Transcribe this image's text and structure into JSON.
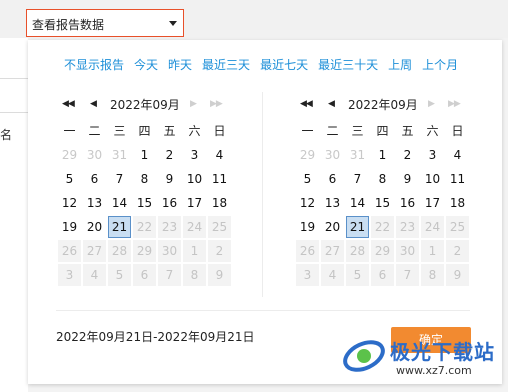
{
  "report_selector": {
    "value": "查看报告数据"
  },
  "table": {
    "column_label": "名"
  },
  "quick_ranges": [
    "不显示报告",
    "今天",
    "昨天",
    "最近三天",
    "最近七天",
    "最近三十天",
    "上周",
    "上个月"
  ],
  "weekdays": [
    "一",
    "二",
    "三",
    "四",
    "五",
    "六",
    "日"
  ],
  "calendars": [
    {
      "title": "2022年09月",
      "days": [
        {
          "d": "29",
          "s": "pre"
        },
        {
          "d": "30",
          "s": "pre"
        },
        {
          "d": "31",
          "s": "pre"
        },
        {
          "d": "1",
          "s": ""
        },
        {
          "d": "2",
          "s": ""
        },
        {
          "d": "3",
          "s": ""
        },
        {
          "d": "4",
          "s": ""
        },
        {
          "d": "5",
          "s": ""
        },
        {
          "d": "6",
          "s": ""
        },
        {
          "d": "7",
          "s": ""
        },
        {
          "d": "8",
          "s": ""
        },
        {
          "d": "9",
          "s": ""
        },
        {
          "d": "10",
          "s": ""
        },
        {
          "d": "11",
          "s": ""
        },
        {
          "d": "12",
          "s": ""
        },
        {
          "d": "13",
          "s": ""
        },
        {
          "d": "14",
          "s": ""
        },
        {
          "d": "15",
          "s": ""
        },
        {
          "d": "16",
          "s": ""
        },
        {
          "d": "17",
          "s": ""
        },
        {
          "d": "18",
          "s": ""
        },
        {
          "d": "19",
          "s": ""
        },
        {
          "d": "20",
          "s": ""
        },
        {
          "d": "21",
          "s": "sel"
        },
        {
          "d": "22",
          "s": "dis"
        },
        {
          "d": "23",
          "s": "dis"
        },
        {
          "d": "24",
          "s": "dis"
        },
        {
          "d": "25",
          "s": "dis"
        },
        {
          "d": "26",
          "s": "dis"
        },
        {
          "d": "27",
          "s": "dis"
        },
        {
          "d": "28",
          "s": "dis"
        },
        {
          "d": "29",
          "s": "dis"
        },
        {
          "d": "30",
          "s": "dis"
        },
        {
          "d": "1",
          "s": "dis"
        },
        {
          "d": "2",
          "s": "dis"
        },
        {
          "d": "3",
          "s": "dis"
        },
        {
          "d": "4",
          "s": "dis"
        },
        {
          "d": "5",
          "s": "dis"
        },
        {
          "d": "6",
          "s": "dis"
        },
        {
          "d": "7",
          "s": "dis"
        },
        {
          "d": "8",
          "s": "dis"
        },
        {
          "d": "9",
          "s": "dis"
        }
      ]
    },
    {
      "title": "2022年09月",
      "days": [
        {
          "d": "29",
          "s": "pre"
        },
        {
          "d": "30",
          "s": "pre"
        },
        {
          "d": "31",
          "s": "pre"
        },
        {
          "d": "1",
          "s": ""
        },
        {
          "d": "2",
          "s": ""
        },
        {
          "d": "3",
          "s": ""
        },
        {
          "d": "4",
          "s": ""
        },
        {
          "d": "5",
          "s": ""
        },
        {
          "d": "6",
          "s": ""
        },
        {
          "d": "7",
          "s": ""
        },
        {
          "d": "8",
          "s": ""
        },
        {
          "d": "9",
          "s": ""
        },
        {
          "d": "10",
          "s": ""
        },
        {
          "d": "11",
          "s": ""
        },
        {
          "d": "12",
          "s": ""
        },
        {
          "d": "13",
          "s": ""
        },
        {
          "d": "14",
          "s": ""
        },
        {
          "d": "15",
          "s": ""
        },
        {
          "d": "16",
          "s": ""
        },
        {
          "d": "17",
          "s": ""
        },
        {
          "d": "18",
          "s": ""
        },
        {
          "d": "19",
          "s": ""
        },
        {
          "d": "20",
          "s": ""
        },
        {
          "d": "21",
          "s": "sel"
        },
        {
          "d": "22",
          "s": "dis"
        },
        {
          "d": "23",
          "s": "dis"
        },
        {
          "d": "24",
          "s": "dis"
        },
        {
          "d": "25",
          "s": "dis"
        },
        {
          "d": "26",
          "s": "dis"
        },
        {
          "d": "27",
          "s": "dis"
        },
        {
          "d": "28",
          "s": "dis"
        },
        {
          "d": "29",
          "s": "dis"
        },
        {
          "d": "30",
          "s": "dis"
        },
        {
          "d": "1",
          "s": "dis"
        },
        {
          "d": "2",
          "s": "dis"
        },
        {
          "d": "3",
          "s": "dis"
        },
        {
          "d": "4",
          "s": "dis"
        },
        {
          "d": "5",
          "s": "dis"
        },
        {
          "d": "6",
          "s": "dis"
        },
        {
          "d": "7",
          "s": "dis"
        },
        {
          "d": "8",
          "s": "dis"
        },
        {
          "d": "9",
          "s": "dis"
        }
      ]
    }
  ],
  "nav_icons": {
    "prev_year": "◀◀",
    "prev_month": "◀",
    "next_month": "▶",
    "next_year": "▶▶"
  },
  "range_text": "2022年09月21日-2022年09月21日",
  "confirm_label": "确定",
  "watermark": {
    "name": "极光下载站",
    "url": "www.xz7.com"
  },
  "colors": {
    "accent": "#f28a30",
    "link": "#1d8fd8",
    "selected_bg": "#c9def2",
    "selected_border": "#5a90c9",
    "selector_border": "#e8502a"
  }
}
